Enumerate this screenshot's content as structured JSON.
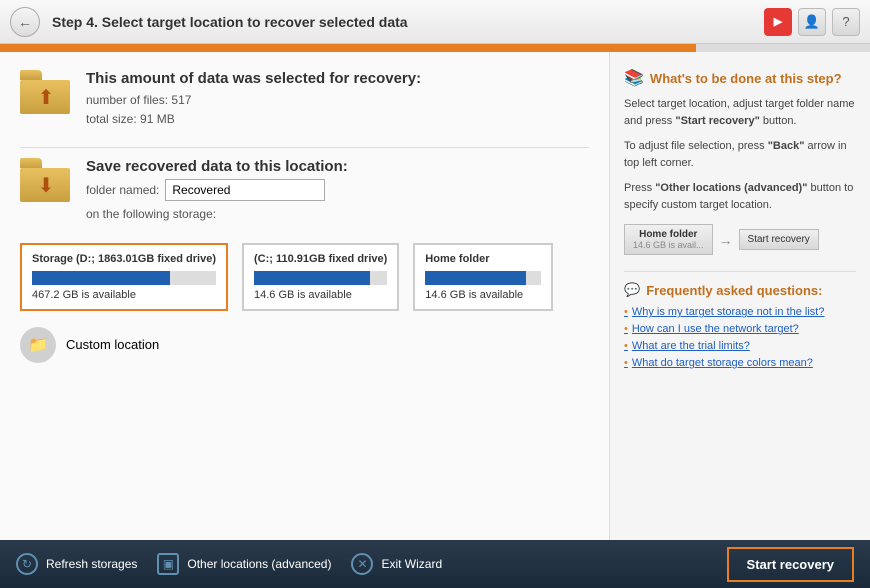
{
  "header": {
    "step_label": "Step 4.",
    "title": " Select target location to recover selected data"
  },
  "progress": {
    "fill_percent": 80
  },
  "recovery_info": {
    "title": "This amount of data was selected for recovery:",
    "files_label": "number of files:",
    "files_count": "517",
    "size_label": "total size:",
    "size_value": "91 MB"
  },
  "save_location": {
    "title": "Save recovered data to this location:",
    "folder_label": "folder named:",
    "folder_value": "Recovered",
    "storage_label": "on the following storage:"
  },
  "storage_cards": [
    {
      "label": "Storage (D:; 1863.01GB fixed drive)",
      "fill_percent": 75,
      "available": "467.2 GB is available",
      "selected": true
    },
    {
      "label": "(C:; 110.91GB fixed drive)",
      "fill_percent": 87,
      "available": "14.6 GB is available",
      "selected": false
    },
    {
      "label": "Home folder",
      "fill_percent": 87,
      "available": "14.6 GB is available",
      "selected": false
    }
  ],
  "custom_location": {
    "label": "Custom location"
  },
  "right_panel": {
    "whats_done_title": "What's to be done at this step?",
    "whats_done_text1": "Select target location, adjust target folder name and press",
    "whats_done_bold1": "\"Start recovery\"",
    "whats_done_text2": " button.",
    "whats_done_text3": "To adjust file selection, press",
    "whats_done_bold2": "\"Back\"",
    "whats_done_text4": " arrow in top left corner.",
    "whats_done_text5": "Press",
    "whats_done_bold3": "\"Other locations (advanced)\"",
    "whats_done_text6": " button to specify custom target location.",
    "mini_folder_label": "Home folder",
    "mini_folder_sub": "14.6 GB is avail...",
    "mini_start_label": "Start recovery",
    "faq_title": "Frequently asked questions:",
    "faq_items": [
      "Why is my target storage not in the list?",
      "How can I use the network target?",
      "What are the trial limits?",
      "What do target storage colors mean?"
    ]
  },
  "footer": {
    "refresh_label": "Refresh storages",
    "other_label": "Other locations (advanced)",
    "exit_label": "Exit Wizard",
    "start_label": "Start recovery"
  }
}
